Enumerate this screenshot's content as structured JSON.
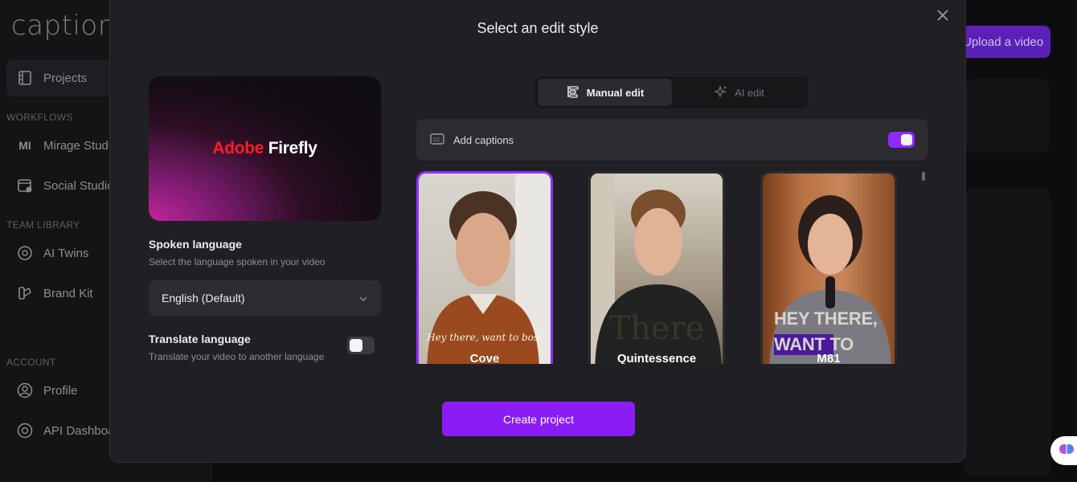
{
  "app": {
    "logo_text": "caption",
    "sidebar": {
      "projects": "Projects",
      "workflows_header": "WORKFLOWS",
      "mirage_studio": "Mirage Studio",
      "social_studio": "Social Studio",
      "team_library_header": "TEAM LIBRARY",
      "ai_twins": "AI Twins",
      "brand_kit": "Brand Kit",
      "account_header": "ACCOUNT",
      "profile": "Profile",
      "api_dashboard": "API Dashboard"
    },
    "upload_button": "Upload a video"
  },
  "modal": {
    "title": "Select an edit style",
    "hero": {
      "brand_adobe": "Adobe",
      "brand_firefly": "Firefly"
    },
    "spoken_language": {
      "label": "Spoken language",
      "description": "Select the language spoken in your video",
      "value": "English (Default)"
    },
    "translate_language": {
      "label": "Translate language",
      "description": "Translate your video to another language",
      "enabled": false
    },
    "edit_modes": {
      "manual": "Manual edit",
      "ai": "AI edit",
      "selected": "manual"
    },
    "captions": {
      "label": "Add captions",
      "enabled": true
    },
    "styles": [
      {
        "name": "Cove",
        "overlay": "Hey there, want to bost",
        "selected": true
      },
      {
        "name": "Quintessence",
        "overlay": "There",
        "selected": false
      },
      {
        "name": "M81",
        "overlay_line1": "HEY THERE,",
        "overlay_line2": "WANT TO",
        "selected": false
      }
    ],
    "create_button": "Create project"
  },
  "colors": {
    "accent": "#8a1cf5",
    "toggle_on": "#8c2bff",
    "modal_bg": "#202024"
  }
}
